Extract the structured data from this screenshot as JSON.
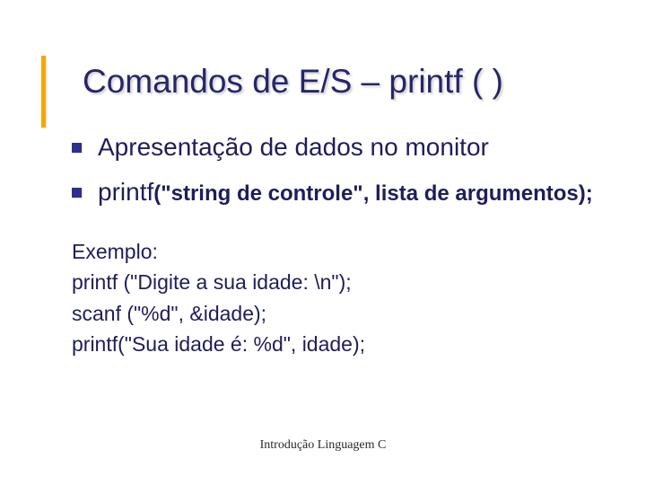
{
  "slide": {
    "title": "Comandos de E/S – printf ( )",
    "bullets": [
      {
        "text": "Apresentação de dados no monitor"
      },
      {
        "prefix": "printf",
        "bold": "(\"string de controle\", lista de argumentos);"
      }
    ],
    "example": {
      "heading": "Exemplo:",
      "lines": [
        "printf (\"Digite a sua idade: \\n\");",
        "scanf (\"%d\", &idade);",
        "printf(\"Sua idade é: %d\", idade);"
      ]
    },
    "footer": "Introdução Linguagem C"
  }
}
